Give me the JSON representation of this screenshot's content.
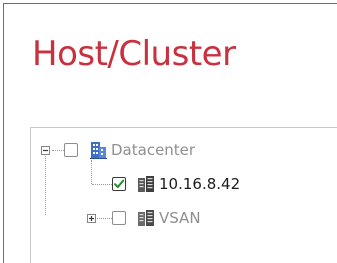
{
  "header": {
    "title": "Host/Cluster"
  },
  "tree": {
    "nodes": [
      {
        "label": "Datacenter",
        "icon": "datacenter-icon",
        "expanded": true,
        "checked": false,
        "toggle": "collapse"
      },
      {
        "label": "10.16.8.42",
        "icon": "host-icon",
        "checked": true
      },
      {
        "label": "VSAN",
        "icon": "cluster-icon",
        "expanded": false,
        "checked": false,
        "toggle": "expand"
      }
    ]
  },
  "colors": {
    "title": "#c9313f",
    "check": "#1f8f2e",
    "datacenter_icon": "#3d6fc4",
    "host_icon": "#4a4a4a",
    "muted_text": "#8f8f8f",
    "active_text": "#1c1c1c"
  }
}
